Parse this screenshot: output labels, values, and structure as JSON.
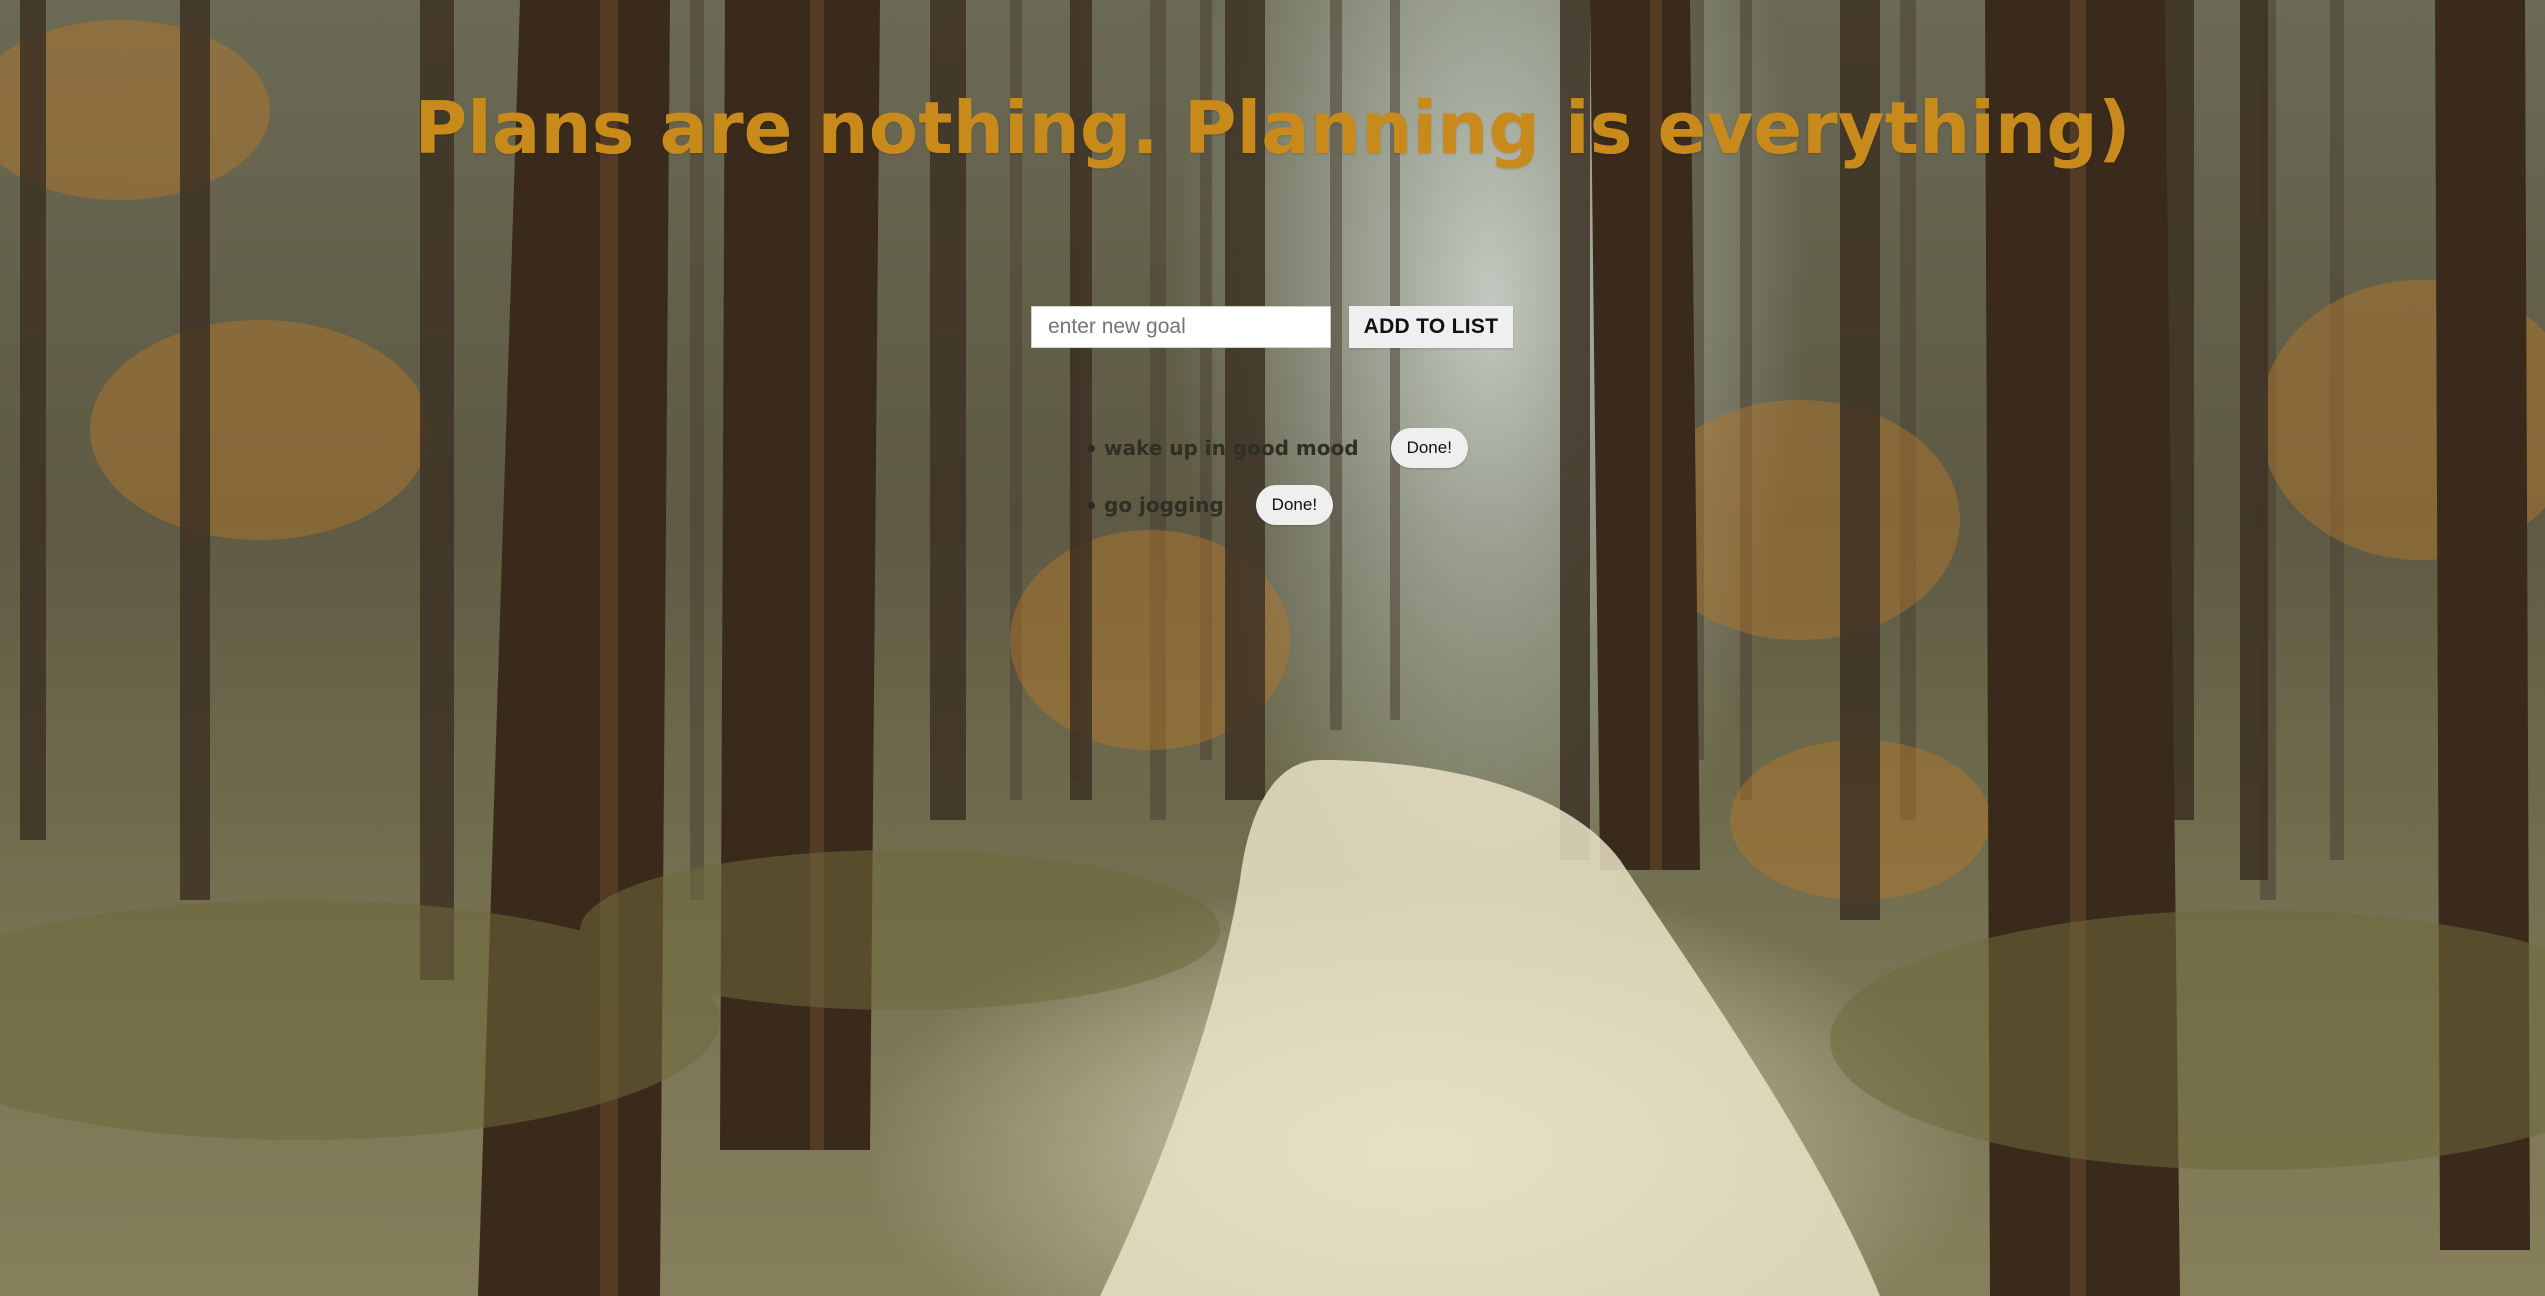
{
  "page": {
    "title": "Plans are nothing. Planning is everything)"
  },
  "form": {
    "input_placeholder": "enter new goal",
    "input_value": "",
    "add_button_label": "ADD TO LIST"
  },
  "goals": [
    {
      "text": "wake up in good mood",
      "button_label": "Done!"
    },
    {
      "text": "go jogging",
      "button_label": "Done!"
    }
  ],
  "colors": {
    "title": "#c98a1c",
    "button_bg": "#efefef",
    "input_bg": "#ffffff"
  },
  "background": {
    "subject": "forest-photo"
  }
}
